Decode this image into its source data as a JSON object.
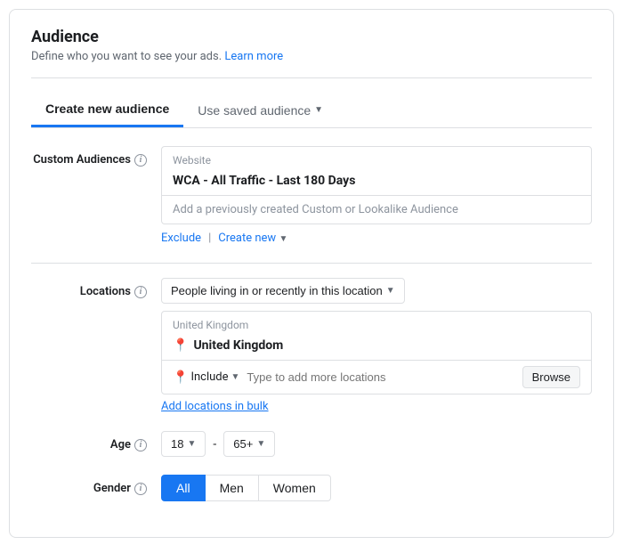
{
  "header": {
    "title": "Audience",
    "subtitle": "Define who you want to see your ads.",
    "learn_more": "Learn more"
  },
  "tabs": [
    {
      "id": "create-new",
      "label": "Create new audience",
      "active": true
    },
    {
      "id": "use-saved",
      "label": "Use saved audience",
      "active": false
    }
  ],
  "custom_audiences": {
    "label": "Custom Audiences",
    "website_label": "Website",
    "selected_item": "WCA - All Traffic - Last 180 Days",
    "placeholder": "Add a previously created Custom or Lookalike Audience",
    "actions": {
      "exclude": "Exclude",
      "create_new": "Create new"
    }
  },
  "locations": {
    "label": "Locations",
    "dropdown_text": "People living in or recently in this location",
    "hint": "United Kingdom",
    "selected": "United Kingdom",
    "include_label": "Include",
    "input_placeholder": "Type to add more locations",
    "browse_label": "Browse",
    "bulk_link": "Add locations in bulk"
  },
  "age": {
    "label": "Age",
    "min": "18",
    "max": "65+",
    "separator": "-"
  },
  "gender": {
    "label": "Gender",
    "options": [
      {
        "id": "all",
        "label": "All",
        "active": true
      },
      {
        "id": "men",
        "label": "Men",
        "active": false
      },
      {
        "id": "women",
        "label": "Women",
        "active": false
      }
    ]
  },
  "colors": {
    "accent": "#1877f2",
    "border": "#dddfe2",
    "text_secondary": "#606770",
    "text_muted": "#8d949e"
  }
}
